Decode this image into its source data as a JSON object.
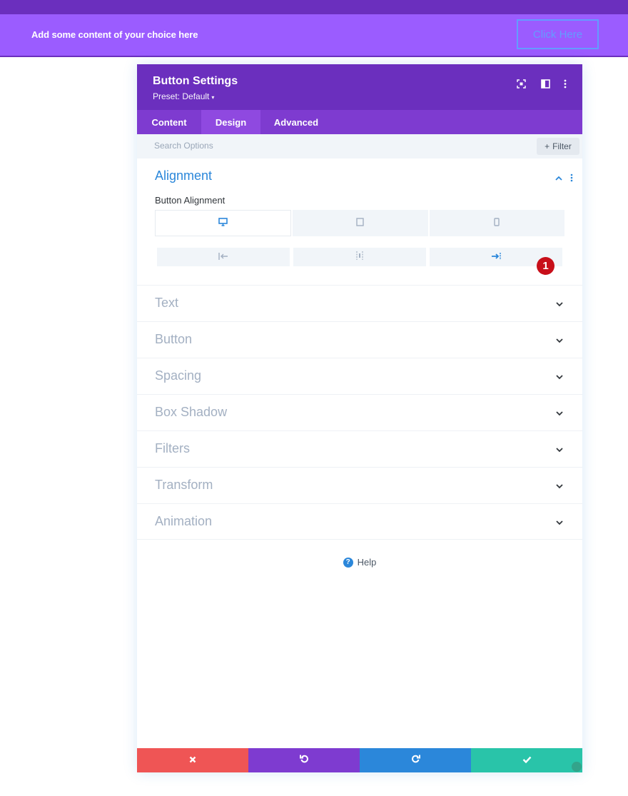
{
  "page": {
    "banner_text": "Add some content of your choice here",
    "banner_button": "Click Here"
  },
  "modal": {
    "title": "Button Settings",
    "preset": "Preset: Default",
    "header_icons": [
      "fullscreen-icon",
      "split-view-icon",
      "more-vertical-icon"
    ],
    "tabs": [
      {
        "label": "Content",
        "active": false
      },
      {
        "label": "Design",
        "active": true
      },
      {
        "label": "Advanced",
        "active": false
      }
    ],
    "search": {
      "placeholder": "Search Options"
    },
    "filter_label": "Filter",
    "open_section": {
      "title": "Alignment",
      "field_label": "Button Alignment",
      "devices": [
        "desktop-icon",
        "tablet-icon",
        "phone-icon"
      ],
      "alignments": [
        "align-left-icon",
        "align-center-icon",
        "align-right-icon"
      ],
      "selected_alignment": "right",
      "badge": "1"
    },
    "sections": [
      "Text",
      "Button",
      "Spacing",
      "Box Shadow",
      "Filters",
      "Transform",
      "Animation"
    ],
    "help_label": "Help",
    "footer": {
      "buttons": [
        "cancel-icon",
        "undo-icon",
        "redo-icon",
        "save-icon"
      ],
      "colors": [
        "#ef5555",
        "#7e3bd0",
        "#2b87da",
        "#29c4a9"
      ]
    }
  },
  "colors": {
    "header": "#6b2fbe",
    "tabs": "#7e3bd0",
    "accent": "#2b87da",
    "banner": "#9b5cff"
  }
}
